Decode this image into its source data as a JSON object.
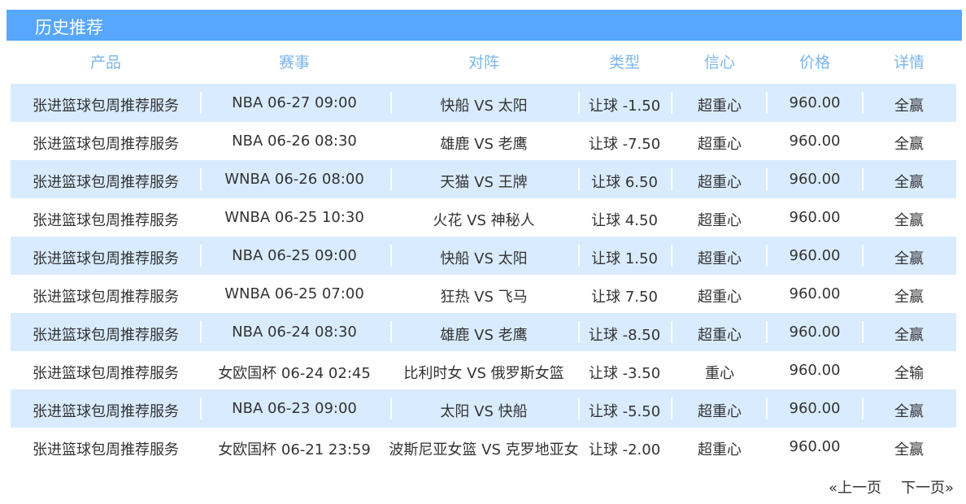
{
  "title": "历史推荐",
  "columns": [
    "产品",
    "赛事",
    "对阵",
    "类型",
    "信心",
    "价格",
    "详情"
  ],
  "rows": [
    {
      "product": "张进篮球包周推荐服务",
      "event": "NBA 06-27 09:00",
      "match": "快船 VS 太阳",
      "type": "让球 -1.50",
      "confidence": "超重心",
      "price": "960.00",
      "detail": "全赢"
    },
    {
      "product": "张进篮球包周推荐服务",
      "event": "NBA 06-26 08:30",
      "match": "雄鹿 VS 老鹰",
      "type": "让球 -7.50",
      "confidence": "超重心",
      "price": "960.00",
      "detail": "全赢"
    },
    {
      "product": "张进篮球包周推荐服务",
      "event": "WNBA 06-26 08:00",
      "match": "天猫 VS 王牌",
      "type": "让球 6.50",
      "confidence": "超重心",
      "price": "960.00",
      "detail": "全赢"
    },
    {
      "product": "张进篮球包周推荐服务",
      "event": "WNBA 06-25 10:30",
      "match": "火花 VS 神秘人",
      "type": "让球 4.50",
      "confidence": "超重心",
      "price": "960.00",
      "detail": "全赢"
    },
    {
      "product": "张进篮球包周推荐服务",
      "event": "NBA 06-25 09:00",
      "match": "快船 VS 太阳",
      "type": "让球 1.50",
      "confidence": "超重心",
      "price": "960.00",
      "detail": "全赢"
    },
    {
      "product": "张进篮球包周推荐服务",
      "event": "WNBA 06-25 07:00",
      "match": "狂热 VS 飞马",
      "type": "让球 7.50",
      "confidence": "超重心",
      "price": "960.00",
      "detail": "全赢"
    },
    {
      "product": "张进篮球包周推荐服务",
      "event": "NBA 06-24 08:30",
      "match": "雄鹿 VS 老鹰",
      "type": "让球 -8.50",
      "confidence": "超重心",
      "price": "960.00",
      "detail": "全赢"
    },
    {
      "product": "张进篮球包周推荐服务",
      "event": "女欧国杯 06-24 02:45",
      "match": "比利时女 VS 俄罗斯女篮",
      "type": "让球 -3.50",
      "confidence": "重心",
      "price": "960.00",
      "detail": "全输"
    },
    {
      "product": "张进篮球包周推荐服务",
      "event": "NBA 06-23 09:00",
      "match": "太阳 VS 快船",
      "type": "让球 -5.50",
      "confidence": "超重心",
      "price": "960.00",
      "detail": "全赢"
    },
    {
      "product": "张进篮球包周推荐服务",
      "event": "女欧国杯 06-21 23:59",
      "match": "波斯尼亚女篮 VS 克罗地亚女",
      "type": "让球 -2.00",
      "confidence": "超重心",
      "price": "960.00",
      "detail": "全赢"
    }
  ],
  "pagination": {
    "prev": "«上一页",
    "next": "下一页»"
  },
  "colors": {
    "title_bar": "#56a7fd",
    "header_text": "#7cb6ea",
    "stripe": "#d9ecff",
    "text": "#333333"
  }
}
